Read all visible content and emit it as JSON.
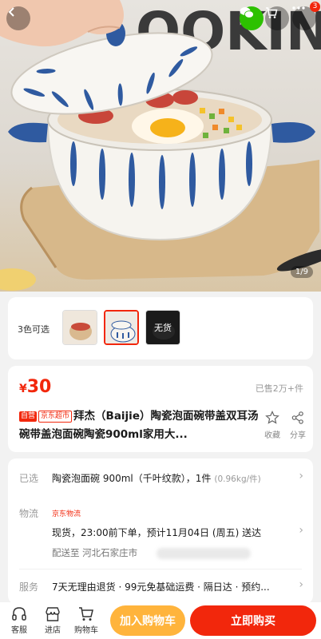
{
  "hero": {
    "background_text": "OOKIN",
    "image_counter": "1/9",
    "cart_badge": "3",
    "icons": [
      "back-icon",
      "wechat-icon",
      "cart-icon",
      "more-icon"
    ]
  },
  "variants": {
    "label": "3色可选",
    "out_of_stock": "无货",
    "selected_index": 1
  },
  "product": {
    "currency": "¥",
    "price": "30",
    "sold": "已售2万+件",
    "tag_self": "自营",
    "tag_store": "京东超市",
    "title": "拜杰（Baijie）陶瓷泡面碗带盖双耳汤碗带盖泡面碗陶瓷900ml家用大...",
    "favorite_label": "收藏",
    "share_label": "分享"
  },
  "details": {
    "selected_label": "已选",
    "selected_value": "陶瓷泡面碗 900ml（千叶纹款），1件",
    "selected_weight": "(0.96kg/件)",
    "logistics_label": "物流",
    "logistics_tag": "京东物流",
    "logistics_value": "现货，23:00前下单，预计11月04日 (周五) 送达",
    "ship_to": "配送至 河北石家庄市",
    "service_label": "服务",
    "service_value": "7天无理由退货 · 99元免基础运费 · 隔日达 · 预约..."
  },
  "bottom_bar": {
    "service": "客服",
    "store": "进店",
    "cart": "购物车",
    "add_to_cart": "加入购物车",
    "buy_now": "立即购买"
  },
  "colors": {
    "accent": "#f2270c",
    "add_to_cart": "#ffb43c",
    "wechat": "#2dc100"
  }
}
